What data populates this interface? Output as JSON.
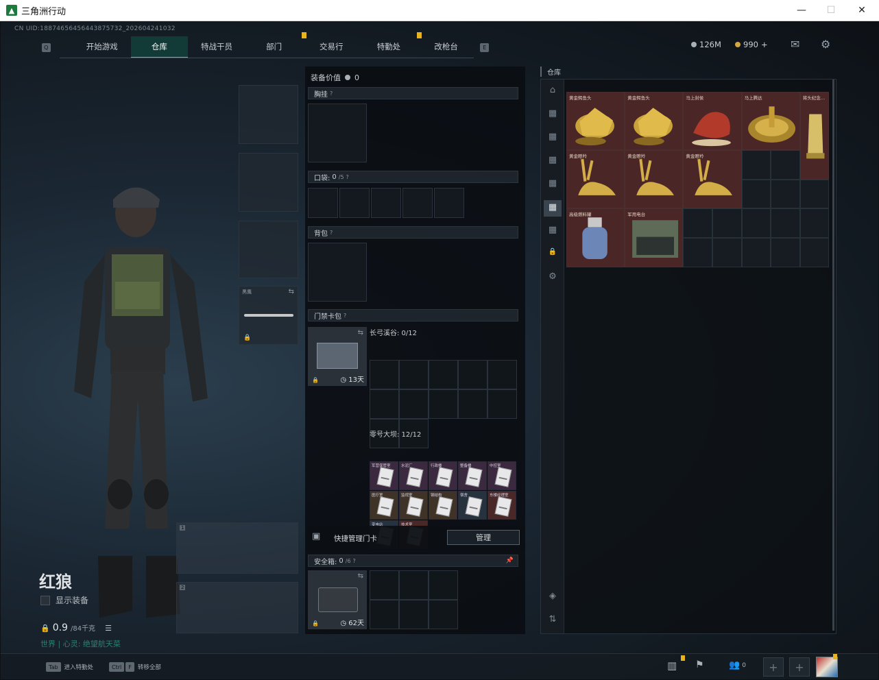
{
  "window": {
    "title": "三角洲行动",
    "minimize": "—",
    "maximize": "☐",
    "close": "✕"
  },
  "uid": "CN UID:18874656456443875732_202604241032",
  "nav": {
    "left_key": "Q",
    "right_key": "E",
    "tabs": [
      {
        "label": "开始游戏"
      },
      {
        "label": "仓库",
        "active": true
      },
      {
        "label": "特战干员"
      },
      {
        "label": "部门",
        "badge": true
      },
      {
        "label": "交易行"
      },
      {
        "label": "特勤处",
        "badge": true
      },
      {
        "label": "改枪台"
      }
    ]
  },
  "currency": {
    "silver": "126M",
    "gold": "990",
    "add": "+"
  },
  "operator": {
    "name": "红狼",
    "show_equipment": "显示装备",
    "weight": "0.9",
    "weight_max": "/84千克",
    "status": "世界 | 心灵: 绝望航天菜"
  },
  "melee": {
    "label": "黑鹰"
  },
  "weapon_slots": [
    "1",
    "2"
  ],
  "loadout": {
    "value_label": "装备价值",
    "value": "0",
    "chest": "胸挂",
    "pocket": "口袋:",
    "pocket_count": "0",
    "pocket_max": "/5",
    "backpack": "背包",
    "keycard_bag": "门禁卡包",
    "keycard_days": "13天",
    "map1": "长弓溪谷: 0/12",
    "map2": "零号大坝: 12/12",
    "quick_manage": "快捷管理门卡",
    "manage_btn": "管理",
    "safebox": "安全箱:",
    "safebox_count": "0",
    "safebox_max": "/6",
    "safebox_days": "62天"
  },
  "keycards": [
    {
      "name": "军营保管室"
    },
    {
      "name": "水泥厂"
    },
    {
      "name": "行政楼"
    },
    {
      "name": "整备楼"
    },
    {
      "name": "中控室"
    },
    {
      "name": "医疗室"
    },
    {
      "name": "监视室"
    },
    {
      "name": "钢结构"
    },
    {
      "name": "宿舍"
    },
    {
      "name": "东楼经理室"
    },
    {
      "name": "变电站"
    },
    {
      "name": "技术室"
    }
  ],
  "warehouse": {
    "title": "仓库",
    "items": [
      {
        "name": "黄金鳄鱼头",
        "icon": "gold-horse-head"
      },
      {
        "name": "黄金鳄鱼头",
        "icon": "gold-horse-head"
      },
      {
        "name": "马上封侯",
        "icon": "red-horse-statue"
      },
      {
        "name": "马上腾达",
        "icon": "horse-compass"
      },
      {
        "name": "将头纪念…",
        "icon": "gold-trophy"
      },
      {
        "name": "黄金瞪羚",
        "icon": "gold-gazelle"
      },
      {
        "name": "黄金瞪羚",
        "icon": "gold-gazelle"
      },
      {
        "name": "黄金瞪羚",
        "icon": "gold-gazelle"
      },
      {
        "name": "高级燃料罐",
        "icon": "gas-canister"
      },
      {
        "name": "军用电台",
        "icon": "military-radio"
      }
    ]
  },
  "bottom": {
    "tab_key": "Tab",
    "tab_label": "进入特勤处",
    "ctrl_key": "Ctrl",
    "f_key": "F",
    "transfer_label": "转移全部",
    "friends": "0",
    "plus": "+"
  }
}
